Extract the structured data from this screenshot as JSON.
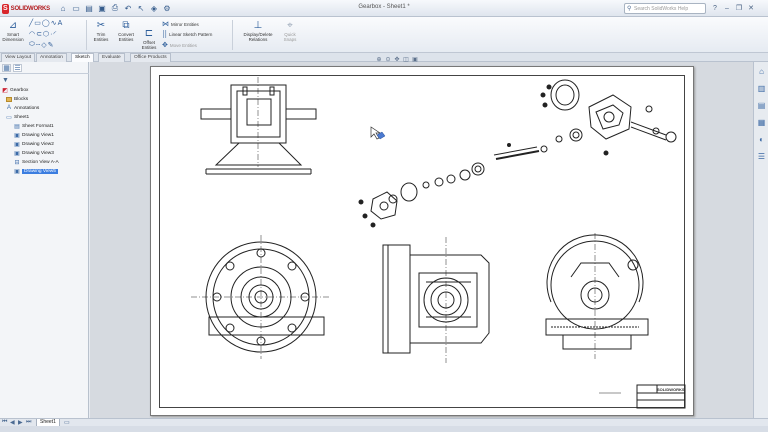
{
  "app": {
    "logo_mark": "S",
    "logo_text": "SOLIDWORKS",
    "window_title": "Gearbox - Sheet1 *",
    "search_placeholder": "Search SolidWorks Help"
  },
  "ribbon": {
    "smart_dimension": "Smart Dimension",
    "trim_entities": "Trim Entities",
    "convert_entities": "Convert Entities",
    "offset_entities": "Offset Entities",
    "mirror_entities": "Mirror Entities",
    "linear_sketch_pattern": "Linear Sketch Pattern",
    "move_entities": "Move Entities",
    "display_delete_relations": "Display/Delete Relations",
    "quick_snaps": "Quick Snaps"
  },
  "tabs": [
    {
      "label": "View Layout"
    },
    {
      "label": "Annotation"
    },
    {
      "label": "Sketch"
    },
    {
      "label": "Evaluate"
    },
    {
      "label": "Office Products"
    }
  ],
  "tree": {
    "root": "Gearbox",
    "blocks": "Blocks",
    "annotations": "Annotations",
    "sheet": "Sheet1",
    "sheet_format": "Sheet Format1",
    "view1": "Drawing View1",
    "view2": "Drawing View2",
    "view3": "Drawing View3",
    "section": "Section View A-A",
    "view5": "Drawing View5"
  },
  "bottom": {
    "sheet_tab": "Sheet1"
  },
  "title_block": {
    "logo": "SOLIDWORKS"
  }
}
